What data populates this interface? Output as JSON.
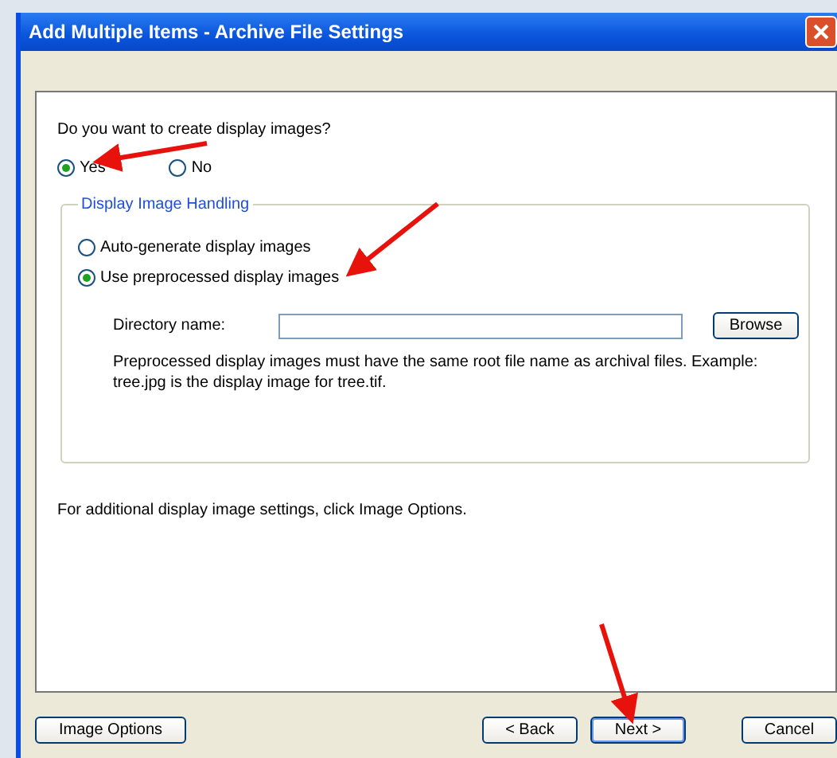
{
  "window": {
    "title": "Add Multiple Items - Archive File Settings"
  },
  "question": {
    "text": "Do you want to create display images?",
    "options": [
      {
        "label": "Yes",
        "selected": true
      },
      {
        "label": "No",
        "selected": false
      }
    ]
  },
  "handling": {
    "title": "Display Image Handling",
    "options": [
      {
        "label": "Auto-generate display images",
        "selected": false
      },
      {
        "label": "Use preprocessed display images",
        "selected": true
      }
    ],
    "directory": {
      "label": "Directory name:",
      "browse": "Browse"
    },
    "note": "Preprocessed display images must have the same root file name as archival files. Example: tree.jpg is the display image for tree.tif."
  },
  "footer_note": "For additional display image settings, click Image Options.",
  "buttons": [
    {
      "kind": "left",
      "label": "Image Options"
    },
    {
      "kind": "nav",
      "label": "< Back"
    },
    {
      "kind": "default",
      "label": "Next >"
    },
    {
      "kind": "cancel",
      "label": "Cancel"
    }
  ]
}
